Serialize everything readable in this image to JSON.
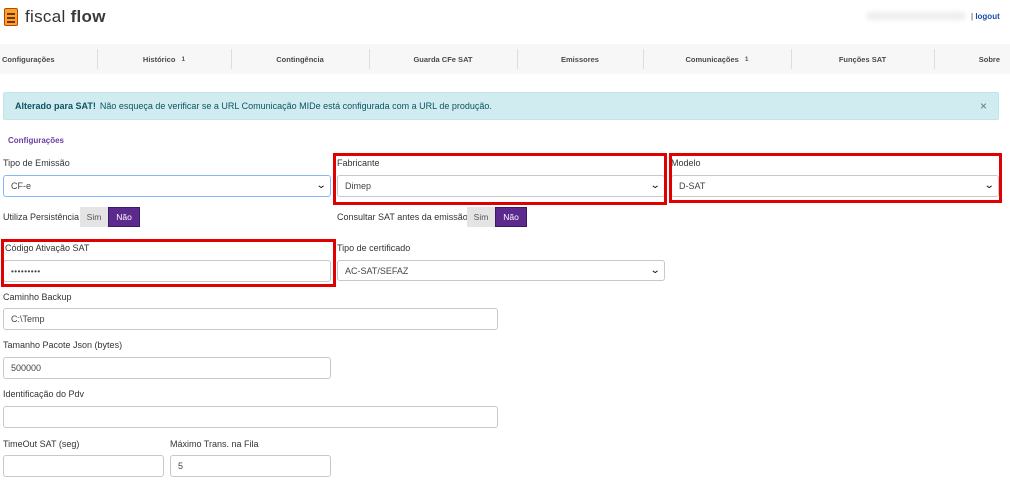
{
  "app": {
    "brand_light": "fiscal ",
    "brand_bold": "flow"
  },
  "header": {
    "logout_sep": "|",
    "logout_label": "logout"
  },
  "nav": {
    "items": [
      {
        "label": "Configurações",
        "badge": ""
      },
      {
        "label": "Histórico",
        "badge": "1"
      },
      {
        "label": "Contingência",
        "badge": ""
      },
      {
        "label": "Guarda CFe SAT",
        "badge": ""
      },
      {
        "label": "Emissores",
        "badge": ""
      },
      {
        "label": "Comunicações",
        "badge": "1"
      },
      {
        "label": "Funções SAT",
        "badge": ""
      },
      {
        "label": "Sobre",
        "badge": ""
      }
    ]
  },
  "alert": {
    "strong": "Alterado para SAT!",
    "message": "Não esqueça de verificar se a URL Comunicação MIDe está configurada com a URL de produção.",
    "close": "×"
  },
  "section": {
    "title": "Configurações"
  },
  "form": {
    "tipo_emissao": {
      "label": "Tipo de Emissão",
      "value": "CF-e"
    },
    "fabricante": {
      "label": "Fabricante",
      "value": "Dimep"
    },
    "modelo": {
      "label": "Modelo",
      "value": "D-SAT"
    },
    "utiliza_persistencia": {
      "label": "Utiliza Persistência",
      "yes": "Sim",
      "no": "Não"
    },
    "consultar_sat": {
      "label": "Consultar SAT antes da emissão",
      "yes": "Sim",
      "no": "Não"
    },
    "codigo_ativacao": {
      "label": "Código Ativação SAT",
      "value": "•••••••••"
    },
    "tipo_certificado": {
      "label": "Tipo de certificado",
      "value": "AC-SAT/SEFAZ"
    },
    "caminho_backup": {
      "label": "Caminho Backup",
      "value": "C:\\Temp"
    },
    "tamanho_pacote": {
      "label": "Tamanho Pacote Json (bytes)",
      "value": "500000"
    },
    "identificacao_pdv": {
      "label": "Identificação do Pdv",
      "value": ""
    },
    "timeout_sat": {
      "label": "TimeOut SAT (seg)",
      "value": ""
    },
    "maximo_trans": {
      "label": "Máximo Trans. na Fila",
      "value": "5"
    }
  },
  "colors": {
    "accent": "#5b2a8c",
    "alert_bg": "#d1ecf1",
    "highlight": "#e00000"
  },
  "icons": {
    "logo": "document-logo-icon",
    "close": "close-icon",
    "select": "chevron-down-icon"
  }
}
